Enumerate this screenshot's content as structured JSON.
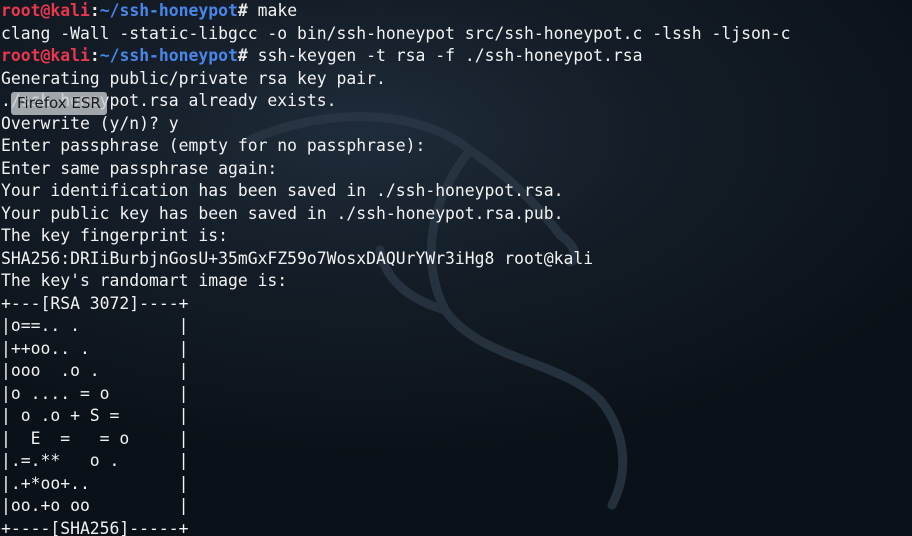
{
  "prompt": {
    "user": "root",
    "at": "@",
    "host": "kali",
    "colon": ":",
    "path": "~/ssh-honeypot",
    "symbol": "# "
  },
  "tooltip": "Firefox ESR",
  "commands": {
    "make": "make",
    "keygen": "ssh-keygen -t rsa -f ./ssh-honeypot.rsa"
  },
  "output": {
    "compile": "clang -Wall -static-libgcc -o bin/ssh-honeypot src/ssh-honeypot.c -lssh -ljson-c",
    "generating": "Generating public/private rsa key pair.",
    "exists": "./ssh-honeypot.rsa already exists.",
    "overwrite": "Overwrite (y/n)? y",
    "passphrase": "Enter passphrase (empty for no passphrase):",
    "passphrase_again": "Enter same passphrase again:",
    "identification": "Your identification has been saved in ./ssh-honeypot.rsa.",
    "public_key": "Your public key has been saved in ./ssh-honeypot.rsa.pub.",
    "fingerprint_label": "The key fingerprint is:",
    "fingerprint": "SHA256:DRIiBurbjnGosU+35mGxFZ59o7WosxDAQUrYWr3iHg8 root@kali",
    "randomart_label": "The key's randomart image is:",
    "randomart": [
      "+---[RSA 3072]----+",
      "|o==.. .          |",
      "|++oo.. .         |",
      "|ooo  .o .        |",
      "|o .... = o       |",
      "| o .o + S =      |",
      "|  E  =   = o     |",
      "|.=.**   o .      |",
      "|.+*oo+..         |",
      "|oo.+o oo         |",
      "+----[SHA256]-----+"
    ]
  },
  "colors": {
    "background": "#0b1118",
    "text": "#f2f2f2",
    "prompt_user": "#e8384f",
    "prompt_path": "#4a86e8"
  }
}
